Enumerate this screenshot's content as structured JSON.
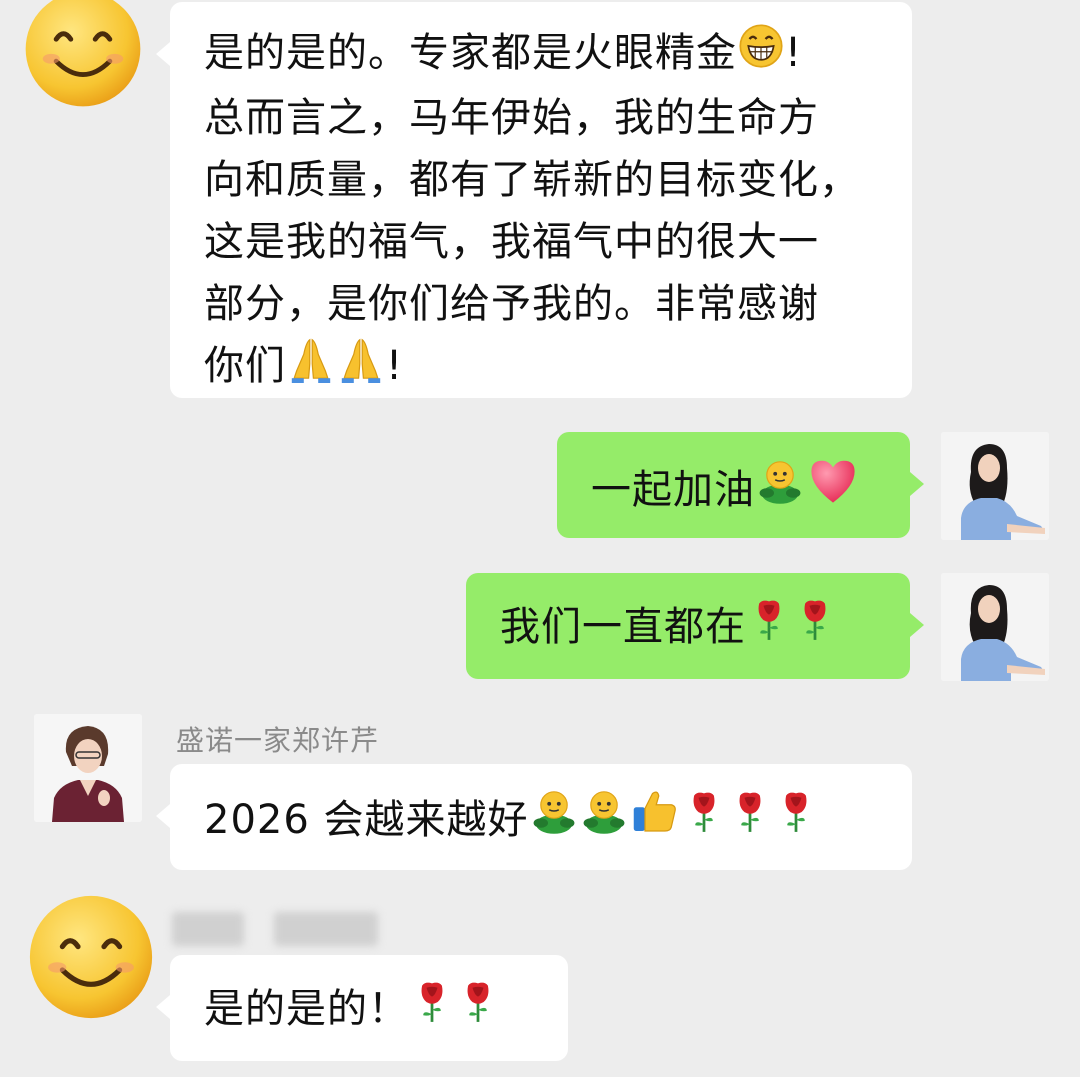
{
  "messages": [
    {
      "id": "m1",
      "side": "left",
      "avatar": "smiley-avatar",
      "lines": [
        [
          "是的是的。专家都是火眼精金",
          {
            "icon": "grinning-face"
          },
          "!"
        ],
        [
          "总而言之，马年伊始，我的生命方"
        ],
        [
          "向和质量，都有了崭新的目标变化，"
        ],
        [
          "这是我的福气，我福气中的很大一"
        ],
        [
          "部分，是你们给予我的。非常感谢"
        ],
        [
          "你们",
          {
            "icon": "folded-hands"
          },
          {
            "icon": "folded-hands"
          },
          "!"
        ]
      ]
    },
    {
      "id": "m2",
      "side": "right",
      "avatar": "woman-photo",
      "text": "一起加油",
      "emojis": [
        "green-figure",
        "red-heart"
      ]
    },
    {
      "id": "m3",
      "side": "right",
      "avatar": "woman-photo",
      "text": "我们一直都在",
      "emojis": [
        "rose",
        "rose"
      ]
    },
    {
      "id": "m4",
      "side": "left",
      "sender": "盛诺一家郑许芹",
      "avatar": "sender-photo",
      "text": "2026 会越来越好",
      "emojis": [
        "green-figure",
        "green-figure",
        "thumbs-up",
        "rose",
        "rose",
        "rose"
      ]
    },
    {
      "id": "m5",
      "side": "left",
      "sender_blurred": true,
      "avatar": "smiley-avatar",
      "text": "是的是的！",
      "emojis": [
        "rose",
        "rose"
      ]
    }
  ],
  "colors": {
    "background": "#ededed",
    "incoming_bubble": "#ffffff",
    "outgoing_bubble": "#95ec69",
    "sender_name": "#8a8a8a"
  }
}
